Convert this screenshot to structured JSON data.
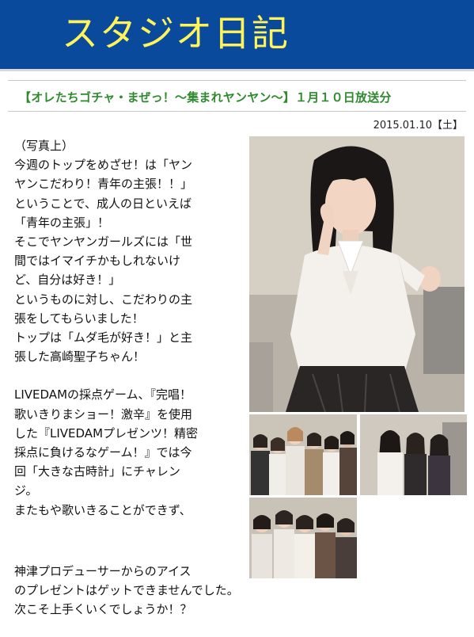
{
  "header": {
    "title": "スタジオ日記"
  },
  "article": {
    "subtitle": "【オレたちゴチャ・まぜっ！～集まれヤンヤン～】１月１０日放送分",
    "date": "2015.01.10【土】",
    "paragraph_lines": [
      "（写真上）",
      "今週のトップをめざせ！は「ヤン",
      "ヤンこだわり！青年の主張！！」",
      "ということで、成人の日といえば",
      "「青年の主張」！",
      "そこでヤンヤンガールズには「世",
      "間ではイマイチかもしれないけ",
      "ど、自分は好き！」",
      "というものに対し、こだわりの主",
      "張をしてもらいました！",
      "トップは「ムダ毛が好き！」と主",
      "張した高崎聖子ちゃん！",
      "",
      "LIVEDAMの採点ゲーム、『完唱！",
      "歌いきりまショー！激辛』を使用",
      "した『LIVEDAMプレゼンツ！精密",
      "採点に負けるなゲーム！』では今",
      "回「大きな古時計」にチャレン",
      "ジ。",
      "またもや歌いきることができず、"
    ],
    "tail_lines": [
      "神津プロデューサーからのアイス",
      "のプレゼントはゲットできませんでした。",
      "次こそ上手くいくでしょうか！？"
    ]
  },
  "colors": {
    "header_bg": "#0a4a9c",
    "header_title": "#fff35a",
    "subtitle": "#2f8a2f"
  }
}
